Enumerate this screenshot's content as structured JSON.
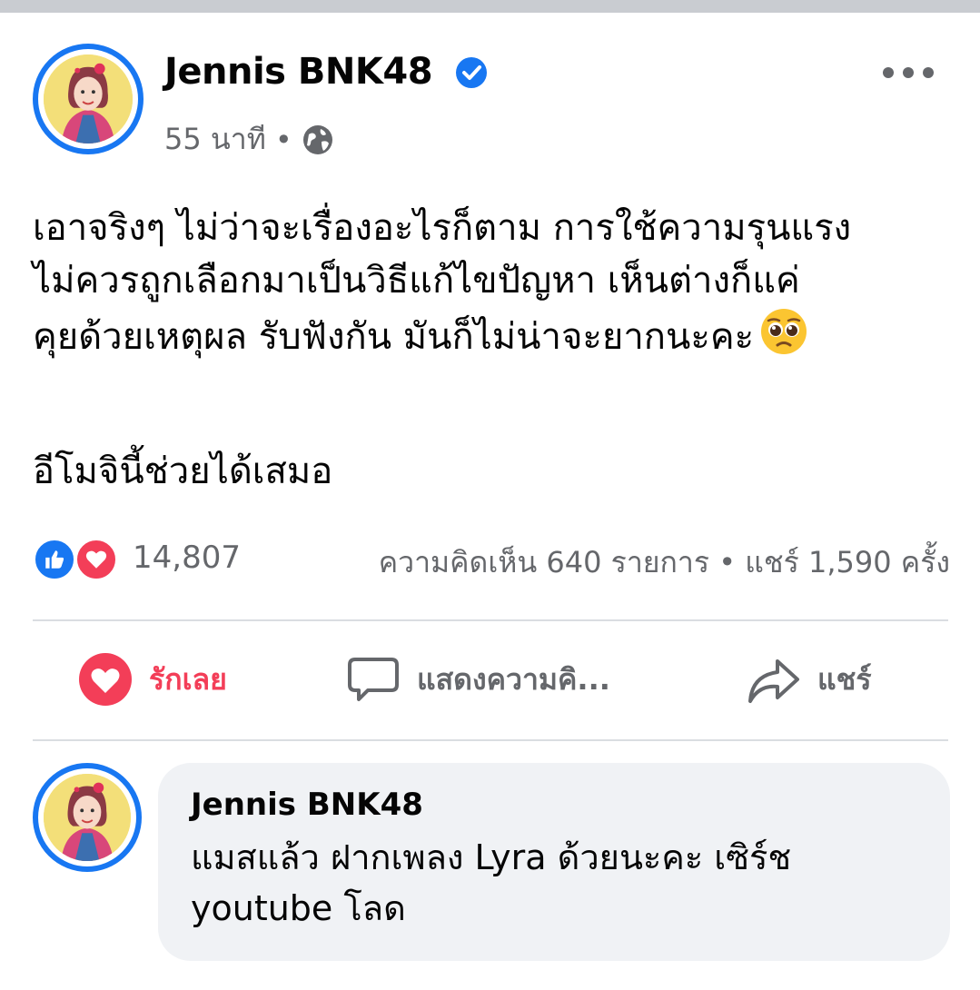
{
  "post": {
    "author": "Jennis BNK48",
    "time": "55 นาที",
    "separator": "•",
    "text": "เอาจริงๆ ไม่ว่าจะเรื่องอะไรก็ตาม การใช้ความรุนแรง\nไม่ควรถูกเลือกมาเป็นวิธีแก้ไขปัญหา  เห็นต่างก็แค่\nคุยด้วยเหตุผล รับฟังกัน มันก็ไม่น่าจะยากนะคะ",
    "text_emoji": "pleading-face-emoji",
    "text_2": "อีโมจินี้ช่วยได้เสมอ",
    "verified_icon": "verified-badge-icon",
    "audience_icon": "globe-icon",
    "more_icon": "more-options-icon"
  },
  "stats": {
    "reaction_count": "14,807",
    "reactions": [
      "like",
      "love"
    ],
    "comments_shares": "ความคิดเห็น 640 รายการ • แชร์ 1,590 ครั้ง"
  },
  "actions": {
    "love_label": "รักเลย",
    "comment_label": "แสดงความคิ...",
    "share_label": "แชร์"
  },
  "comment": {
    "author": "Jennis BNK48",
    "text": "แมสแล้ว ฝากเพลง Lyra ด้วยนะคะ เซิร์ช\nyoutube โลด"
  },
  "colors": {
    "accent": "#1877f2",
    "love": "#f33e58",
    "secondary_text": "#65676b",
    "bubble": "#f0f2f5",
    "divider": "#dadde1"
  }
}
